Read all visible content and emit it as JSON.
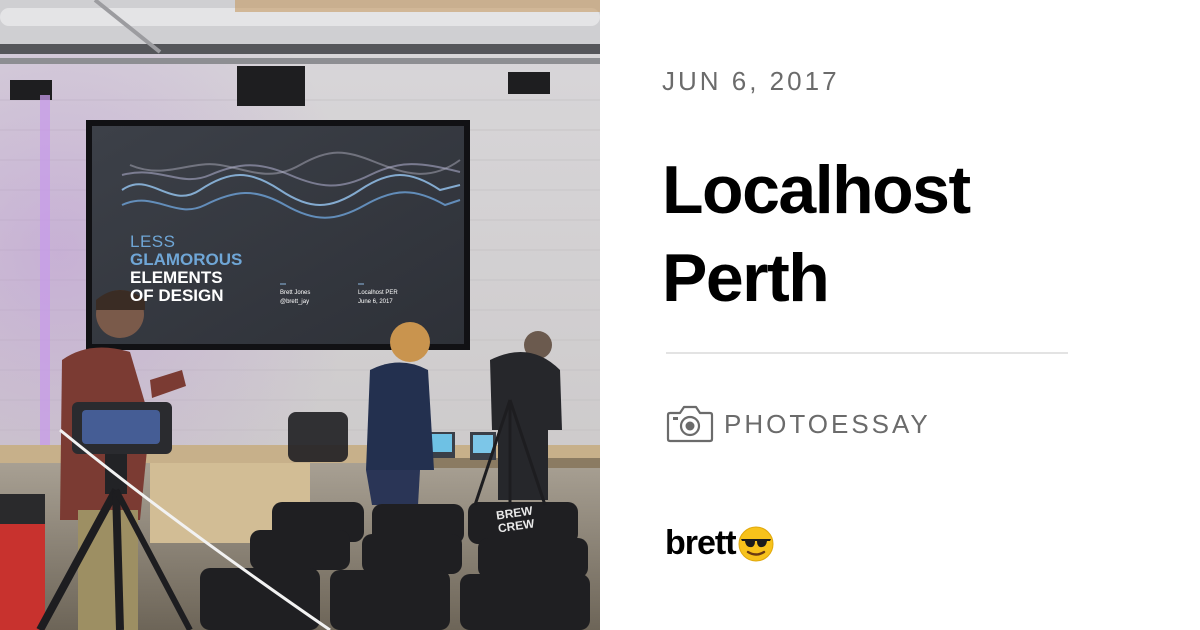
{
  "photo": {
    "alt": "Localhost Perth event room with projector screen",
    "slide": {
      "line1": "LESS",
      "line2": "GLAMOROUS",
      "line3": "ELEMENTS",
      "line4": "OF DESIGN",
      "speaker_name": "Brett Jones",
      "speaker_handle": "@brett_jay",
      "event_name": "Localhost PER",
      "event_date": "June 6, 2017"
    },
    "shirt_text_line1": "BREW",
    "shirt_text_line2": "CREW"
  },
  "post": {
    "date": "JUN 6, 2017",
    "title_line1": "Localhost",
    "title_line2": "Perth",
    "category_icon": "camera-icon",
    "category": "PHOTOESSAY"
  },
  "brand": {
    "name": "brett",
    "emoji_icon": "sunglasses-emoji-icon"
  },
  "colors": {
    "background": "#ffffff",
    "title": "#000000",
    "meta": "#6b6b6b",
    "divider": "#e3e3e3"
  }
}
